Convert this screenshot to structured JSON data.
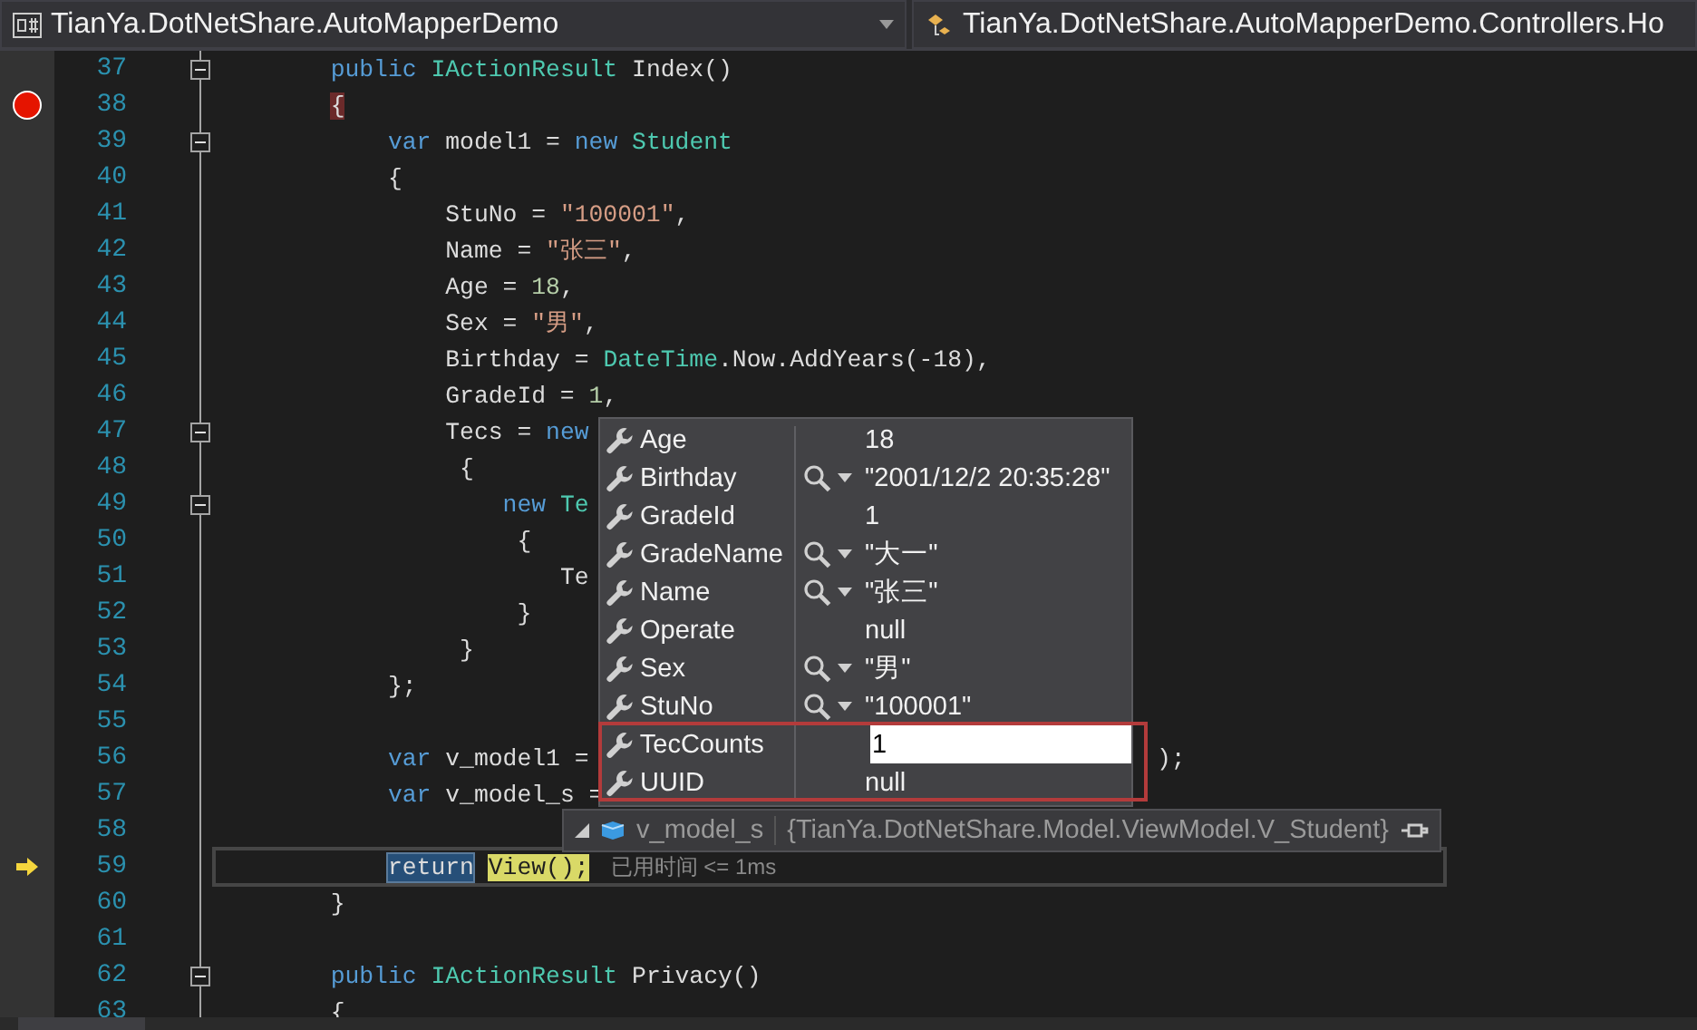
{
  "toolbar": {
    "project": "TianYa.DotNetShare.AutoMapperDemo",
    "member": "TianYa.DotNetShare.AutoMapperDemo.Controllers.Ho"
  },
  "lines": [
    {
      "number": "37",
      "fold": true,
      "breakpoint": false,
      "current": false,
      "tokens": [
        {
          "kind": "kw",
          "text": "        public"
        },
        {
          "kind": "type",
          "text": " IActionResult"
        },
        {
          "kind": "plain",
          "text": " Index()"
        }
      ]
    },
    {
      "number": "38",
      "fold": false,
      "breakpoint": true,
      "current": false,
      "tokens": [
        {
          "kind": "match",
          "text": "        {"
        }
      ]
    },
    {
      "number": "39",
      "fold": true,
      "breakpoint": false,
      "current": false,
      "tokens": [
        {
          "kind": "kw",
          "text": "            var"
        },
        {
          "kind": "plain",
          "text": " model1 = "
        },
        {
          "kind": "kw",
          "text": "new"
        },
        {
          "kind": "type",
          "text": " Student"
        }
      ]
    },
    {
      "number": "40",
      "fold": false,
      "breakpoint": false,
      "current": false,
      "tokens": [
        {
          "kind": "plain",
          "text": "            {"
        }
      ]
    },
    {
      "number": "41",
      "fold": false,
      "breakpoint": false,
      "current": false,
      "tokens": [
        {
          "kind": "plain",
          "text": "                StuNo = "
        },
        {
          "kind": "str",
          "text": "\"100001\""
        },
        {
          "kind": "plain",
          "text": ","
        }
      ]
    },
    {
      "number": "42",
      "fold": false,
      "breakpoint": false,
      "current": false,
      "tokens": [
        {
          "kind": "plain",
          "text": "                Name = "
        },
        {
          "kind": "str",
          "text": "\"张三\""
        },
        {
          "kind": "plain",
          "text": ","
        }
      ]
    },
    {
      "number": "43",
      "fold": false,
      "breakpoint": false,
      "current": false,
      "tokens": [
        {
          "kind": "plain",
          "text": "                Age = "
        },
        {
          "kind": "num",
          "text": "18"
        },
        {
          "kind": "plain",
          "text": ","
        }
      ]
    },
    {
      "number": "44",
      "fold": false,
      "breakpoint": false,
      "current": false,
      "tokens": [
        {
          "kind": "plain",
          "text": "                Sex = "
        },
        {
          "kind": "str",
          "text": "\"男\""
        },
        {
          "kind": "plain",
          "text": ","
        }
      ]
    },
    {
      "number": "45",
      "fold": false,
      "breakpoint": false,
      "current": false,
      "tokens": [
        {
          "kind": "plain",
          "text": "                Birthday = "
        },
        {
          "kind": "type",
          "text": "DateTime"
        },
        {
          "kind": "plain",
          "text": ".Now.AddYears(-18),"
        }
      ]
    },
    {
      "number": "46",
      "fold": false,
      "breakpoint": false,
      "current": false,
      "tokens": [
        {
          "kind": "plain",
          "text": "                GradeId = "
        },
        {
          "kind": "num",
          "text": "1"
        },
        {
          "kind": "plain",
          "text": ","
        }
      ]
    },
    {
      "number": "47",
      "fold": true,
      "breakpoint": false,
      "current": false,
      "tokens": [
        {
          "kind": "plain",
          "text": "                Tecs = "
        },
        {
          "kind": "kw",
          "text": "new"
        }
      ]
    },
    {
      "number": "48",
      "fold": false,
      "breakpoint": false,
      "current": false,
      "tokens": [
        {
          "kind": "plain",
          "text": "                 {"
        }
      ]
    },
    {
      "number": "49",
      "fold": true,
      "breakpoint": false,
      "current": false,
      "tokens": [
        {
          "kind": "kw",
          "text": "                    new"
        },
        {
          "kind": "type",
          "text": " Te"
        }
      ]
    },
    {
      "number": "50",
      "fold": false,
      "breakpoint": false,
      "current": false,
      "tokens": [
        {
          "kind": "plain",
          "text": "                     {"
        }
      ]
    },
    {
      "number": "51",
      "fold": false,
      "breakpoint": false,
      "current": false,
      "tokens": [
        {
          "kind": "plain",
          "text": "                        Te"
        }
      ]
    },
    {
      "number": "52",
      "fold": false,
      "breakpoint": false,
      "current": false,
      "tokens": [
        {
          "kind": "plain",
          "text": "                     }"
        }
      ]
    },
    {
      "number": "53",
      "fold": false,
      "breakpoint": false,
      "current": false,
      "tokens": [
        {
          "kind": "plain",
          "text": "                 }"
        }
      ]
    },
    {
      "number": "54",
      "fold": false,
      "breakpoint": false,
      "current": false,
      "tokens": [
        {
          "kind": "plain",
          "text": "            };"
        }
      ]
    },
    {
      "number": "55",
      "fold": false,
      "breakpoint": false,
      "current": false
    },
    {
      "number": "56",
      "fold": false,
      "breakpoint": false,
      "current": false,
      "tokens": [
        {
          "kind": "kw",
          "text": "            var"
        },
        {
          "kind": "plain",
          "text": " v_model1 ="
        },
        {
          "kind": "tail",
          "text": ");"
        }
      ]
    },
    {
      "number": "57",
      "fold": false,
      "breakpoint": false,
      "current": false,
      "tokens": [
        {
          "kind": "kw",
          "text": "            var"
        },
        {
          "kind": "plain",
          "text": " v_model_s ="
        }
      ]
    },
    {
      "number": "58",
      "fold": false,
      "breakpoint": false,
      "current": false
    },
    {
      "number": "59",
      "fold": false,
      "breakpoint": false,
      "current": true,
      "tokens": [
        {
          "kind": "sel",
          "text": "            return"
        },
        {
          "kind": "exec",
          "text": " View();"
        },
        {
          "kind": "perf",
          "text": "已用时间 <= 1ms"
        }
      ]
    },
    {
      "number": "60",
      "fold": false,
      "breakpoint": false,
      "current": false,
      "tokens": [
        {
          "kind": "plain",
          "text": "        }"
        }
      ]
    },
    {
      "number": "61",
      "fold": false,
      "breakpoint": false,
      "current": false
    },
    {
      "number": "62",
      "fold": true,
      "breakpoint": false,
      "current": false,
      "tokens": [
        {
          "kind": "kw",
          "text": "        public"
        },
        {
          "kind": "type",
          "text": " IActionResult"
        },
        {
          "kind": "plain",
          "text": " Privacy()"
        }
      ]
    },
    {
      "number": "63",
      "fold": false,
      "breakpoint": false,
      "current": false,
      "tokens": [
        {
          "kind": "plain",
          "text": "        {"
        }
      ]
    }
  ],
  "datatip": {
    "members": [
      {
        "name": "Age",
        "value": "18",
        "visualizer": false,
        "editing": false,
        "highlighted": false
      },
      {
        "name": "Birthday",
        "value": "\"2001/12/2 20:35:28\"",
        "visualizer": true,
        "editing": false,
        "highlighted": false
      },
      {
        "name": "GradeId",
        "value": "1",
        "visualizer": false,
        "editing": false,
        "highlighted": false
      },
      {
        "name": "GradeName",
        "value": "\"大一\"",
        "visualizer": true,
        "editing": false,
        "highlighted": false
      },
      {
        "name": "Name",
        "value": "\"张三\"",
        "visualizer": true,
        "editing": false,
        "highlighted": false
      },
      {
        "name": "Operate",
        "value": "null",
        "visualizer": false,
        "editing": false,
        "highlighted": false
      },
      {
        "name": "Sex",
        "value": "\"男\"",
        "visualizer": true,
        "editing": false,
        "highlighted": false
      },
      {
        "name": "StuNo",
        "value": "\"100001\"",
        "visualizer": true,
        "editing": false,
        "highlighted": false
      },
      {
        "name": "TecCounts",
        "value": "1",
        "visualizer": false,
        "editing": true,
        "highlighted": true
      },
      {
        "name": "UUID",
        "value": "null",
        "visualizer": false,
        "editing": false,
        "highlighted": true
      }
    ],
    "root": {
      "name": "v_model_s",
      "value": "{TianYa.DotNetShare.Model.ViewModel.V_Student}"
    }
  }
}
